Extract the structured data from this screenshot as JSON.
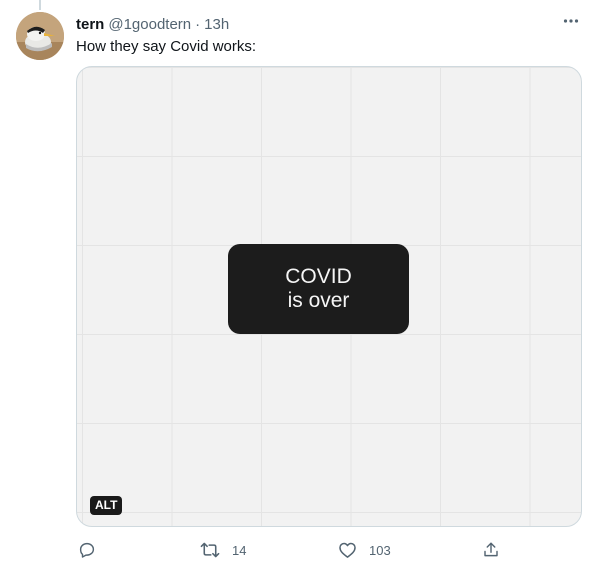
{
  "tweet": {
    "author_name": "tern",
    "author_handle": "@1goodtern",
    "separator": "·",
    "timestamp": "13h",
    "text": "How they say Covid works:",
    "media": {
      "line1": "COVID",
      "line2": "is over",
      "alt_badge": "ALT"
    },
    "actions": {
      "retweet_count": "14",
      "like_count": "103"
    }
  },
  "icons": [
    "more-icon",
    "reply-icon",
    "retweet-icon",
    "like-icon",
    "share-icon"
  ],
  "colors": {
    "text_primary": "#0f1419",
    "text_secondary": "#536471",
    "image_background": "#f2f2f2",
    "image_box": "#1c1c1c"
  }
}
